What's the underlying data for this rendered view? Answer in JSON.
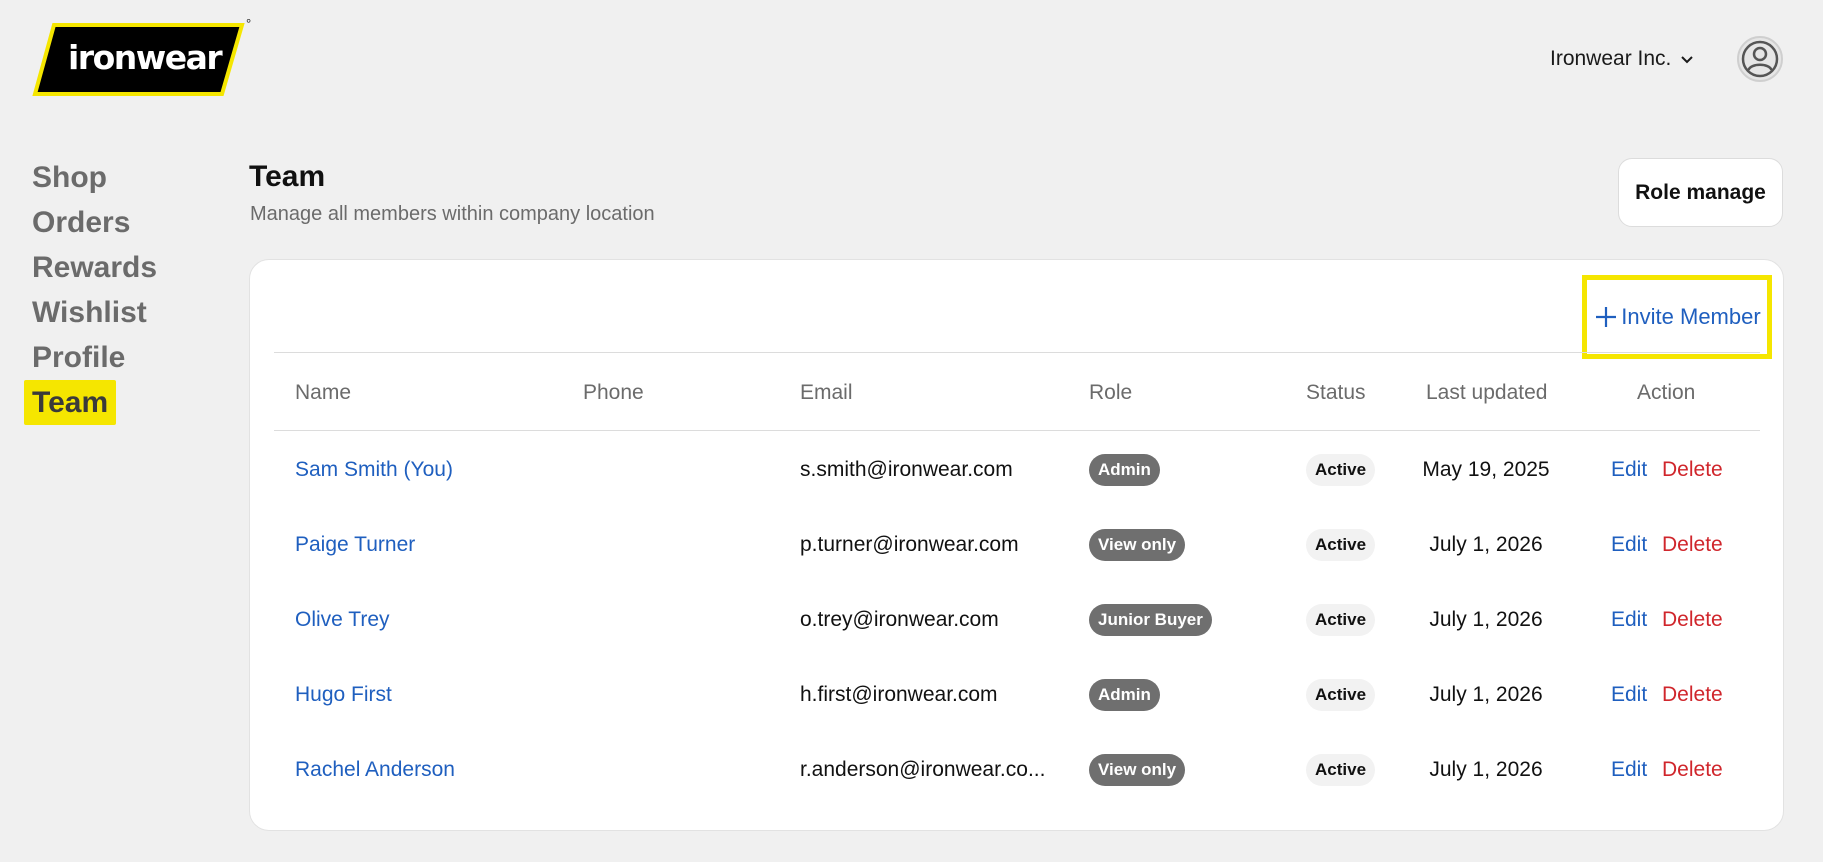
{
  "brand": {
    "logo_text": "ironwear",
    "registered_mark": "°",
    "logo_fill": "#000000",
    "logo_outline": "#f5e600"
  },
  "header": {
    "company": "Ironwear Inc.",
    "avatar_icon": "user-circle-icon"
  },
  "sidebar": {
    "items": [
      {
        "label": "Shop"
      },
      {
        "label": "Orders"
      },
      {
        "label": "Rewards"
      },
      {
        "label": "Wishlist"
      },
      {
        "label": "Profile"
      },
      {
        "label": "Team",
        "active": true
      }
    ]
  },
  "page": {
    "title": "Team",
    "subtitle": "Manage all members within company location",
    "role_manage_label": "Role manage",
    "invite_label": "Invite Member"
  },
  "table": {
    "headers": {
      "name": "Name",
      "phone": "Phone",
      "email": "Email",
      "role": "Role",
      "status": "Status",
      "updated": "Last updated",
      "action": "Action"
    },
    "rows": [
      {
        "name": "Sam Smith (You)",
        "phone": "",
        "email": "s.smith@ironwear.com",
        "role": "Admin",
        "status": "Active",
        "updated": "May 19, 2025",
        "edit": "Edit",
        "delete": "Delete"
      },
      {
        "name": "Paige Turner",
        "phone": "",
        "email": "p.turner@ironwear.com",
        "role": "View only",
        "status": "Active",
        "updated": "July 1, 2026",
        "edit": "Edit",
        "delete": "Delete"
      },
      {
        "name": "Olive Trey",
        "phone": "",
        "email": "o.trey@ironwear.com",
        "role": "Junior Buyer",
        "status": "Active",
        "updated": "July 1, 2026",
        "edit": "Edit",
        "delete": "Delete"
      },
      {
        "name": "Hugo First",
        "phone": "",
        "email": "h.first@ironwear.com",
        "role": "Admin",
        "status": "Active",
        "updated": "July 1, 2026",
        "edit": "Edit",
        "delete": "Delete"
      },
      {
        "name": "Rachel Anderson",
        "phone": "",
        "email": "r.anderson@ironwear.co...",
        "role": "View only",
        "status": "Active",
        "updated": "July 1, 2026",
        "edit": "Edit",
        "delete": "Delete"
      }
    ]
  },
  "colors": {
    "link_blue": "#1f5fbf",
    "delete_red": "#d0262c",
    "highlight_yellow": "#f5e600",
    "page_bg": "#f0f0f0"
  }
}
